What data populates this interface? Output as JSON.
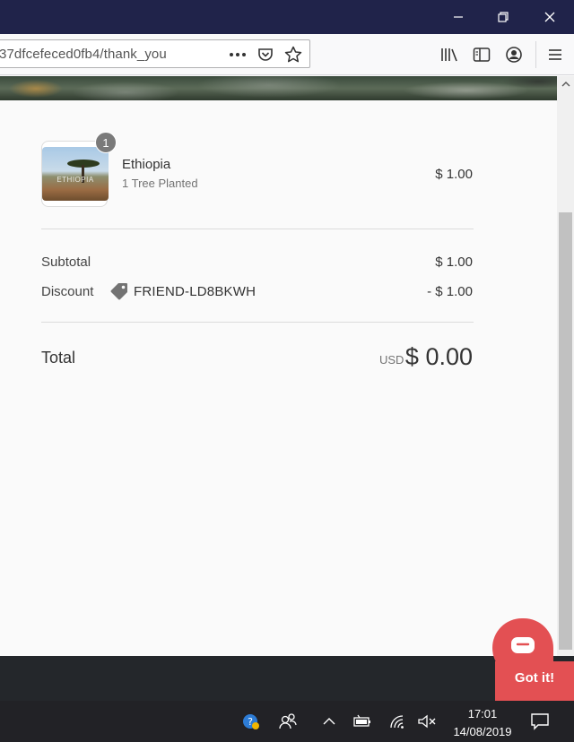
{
  "browser": {
    "url": "37dfcefeced0fb4/thank_you"
  },
  "order": {
    "item": {
      "name": "Ethiopia",
      "variant": "1 Tree Planted",
      "price": "$ 1.00",
      "quantity": "1",
      "image_label": "ETHIOPIA"
    },
    "subtotal_label": "Subtotal",
    "subtotal_value": "$ 1.00",
    "discount_label": "Discount",
    "discount_code": "FRIEND-LD8BKWH",
    "discount_value": "- $ 1.00",
    "total_label": "Total",
    "currency": "USD",
    "total_value": "$ 0.00"
  },
  "chat": {
    "button_label": "Got it!"
  },
  "taskbar": {
    "time": "17:01",
    "date": "14/08/2019"
  },
  "colors": {
    "titlebar": "#20234a",
    "chat_accent": "#e35053"
  }
}
